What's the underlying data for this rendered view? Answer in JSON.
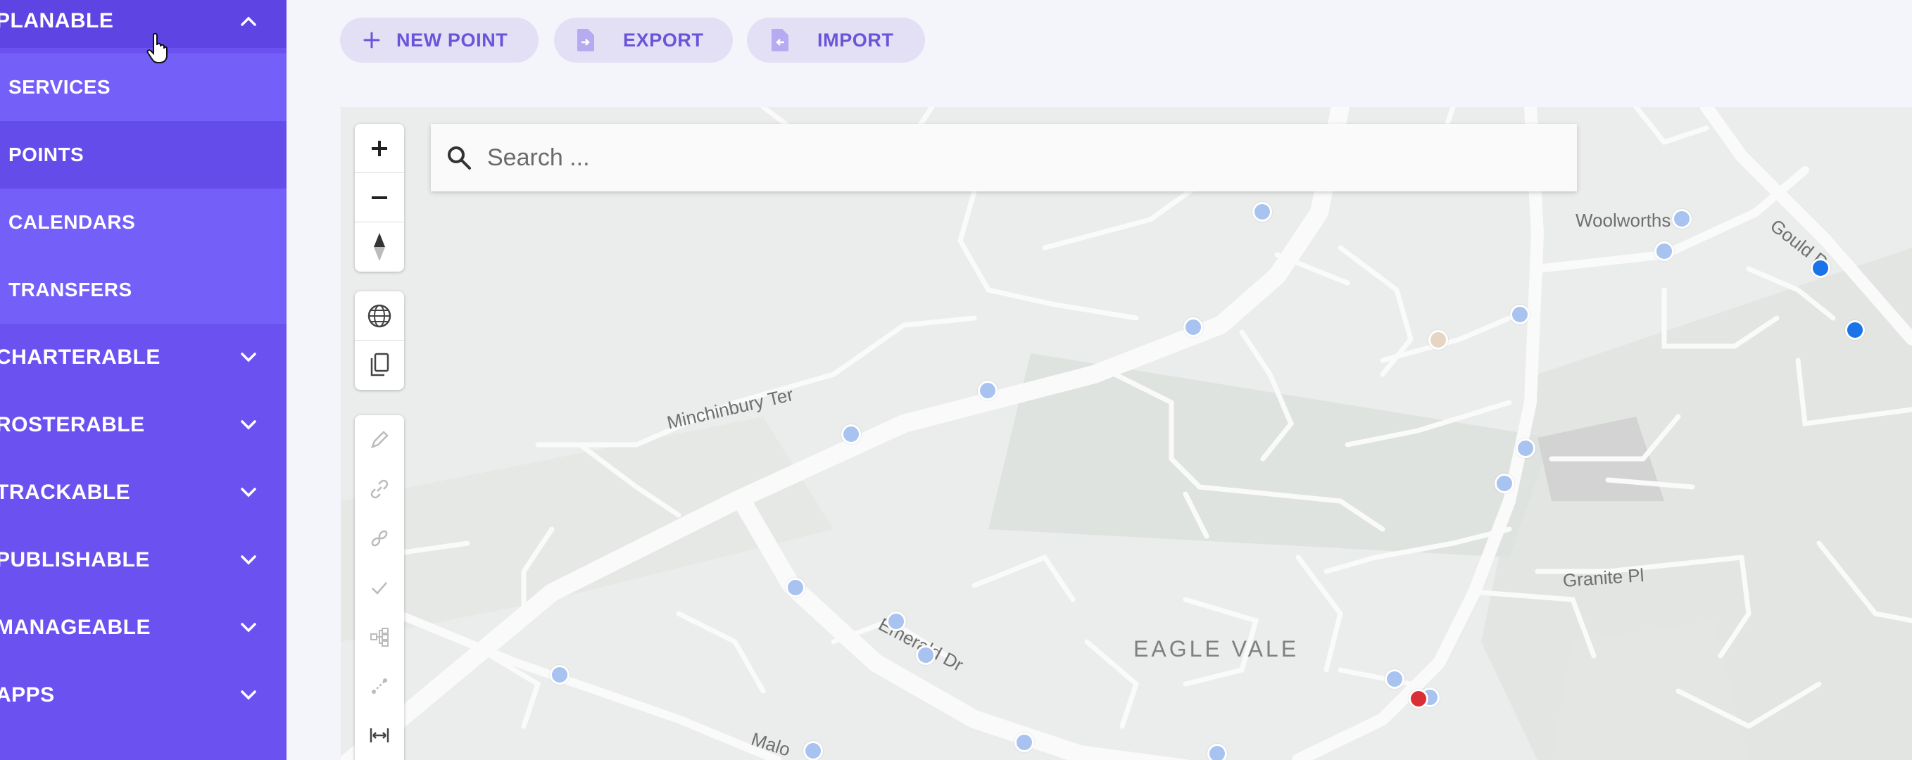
{
  "sidebar": {
    "sections": [
      {
        "label": "PLANABLE",
        "state": "expanded"
      },
      {
        "label": "CHARTERABLE",
        "state": "collapsed"
      },
      {
        "label": "ROSTERABLE",
        "state": "collapsed"
      },
      {
        "label": "TRACKABLE",
        "state": "collapsed"
      },
      {
        "label": "PUBLISHABLE",
        "state": "collapsed"
      },
      {
        "label": "MANAGEABLE",
        "state": "collapsed"
      },
      {
        "label": "APPS",
        "state": "collapsed"
      }
    ],
    "planable_items": [
      {
        "label": "SERVICES"
      },
      {
        "label": "POINTS",
        "active": true
      },
      {
        "label": "CALENDARS"
      },
      {
        "label": "TRANSFERS"
      }
    ]
  },
  "toolbar": {
    "new_point": "NEW POINT",
    "export": "EXPORT",
    "import": "IMPORT"
  },
  "map": {
    "search_placeholder": "Search ...",
    "labels": {
      "minchinbury": "Minchinbury Ter",
      "woolworths": "Woolworths",
      "gould": "Gould P",
      "granite": "Granite Pl",
      "emerald": "Emerald Dr",
      "eagle_vale": "EAGLE VALE",
      "malo": "Malo"
    },
    "colors": {
      "pin_light": "#a9c3f0",
      "pin_blue": "#1a73e8",
      "pin_red": "#d93036",
      "pin_tan": "#e6d5c2"
    }
  },
  "colors": {
    "sidebar": "#6b52f0",
    "accent": "#6a55d9"
  }
}
